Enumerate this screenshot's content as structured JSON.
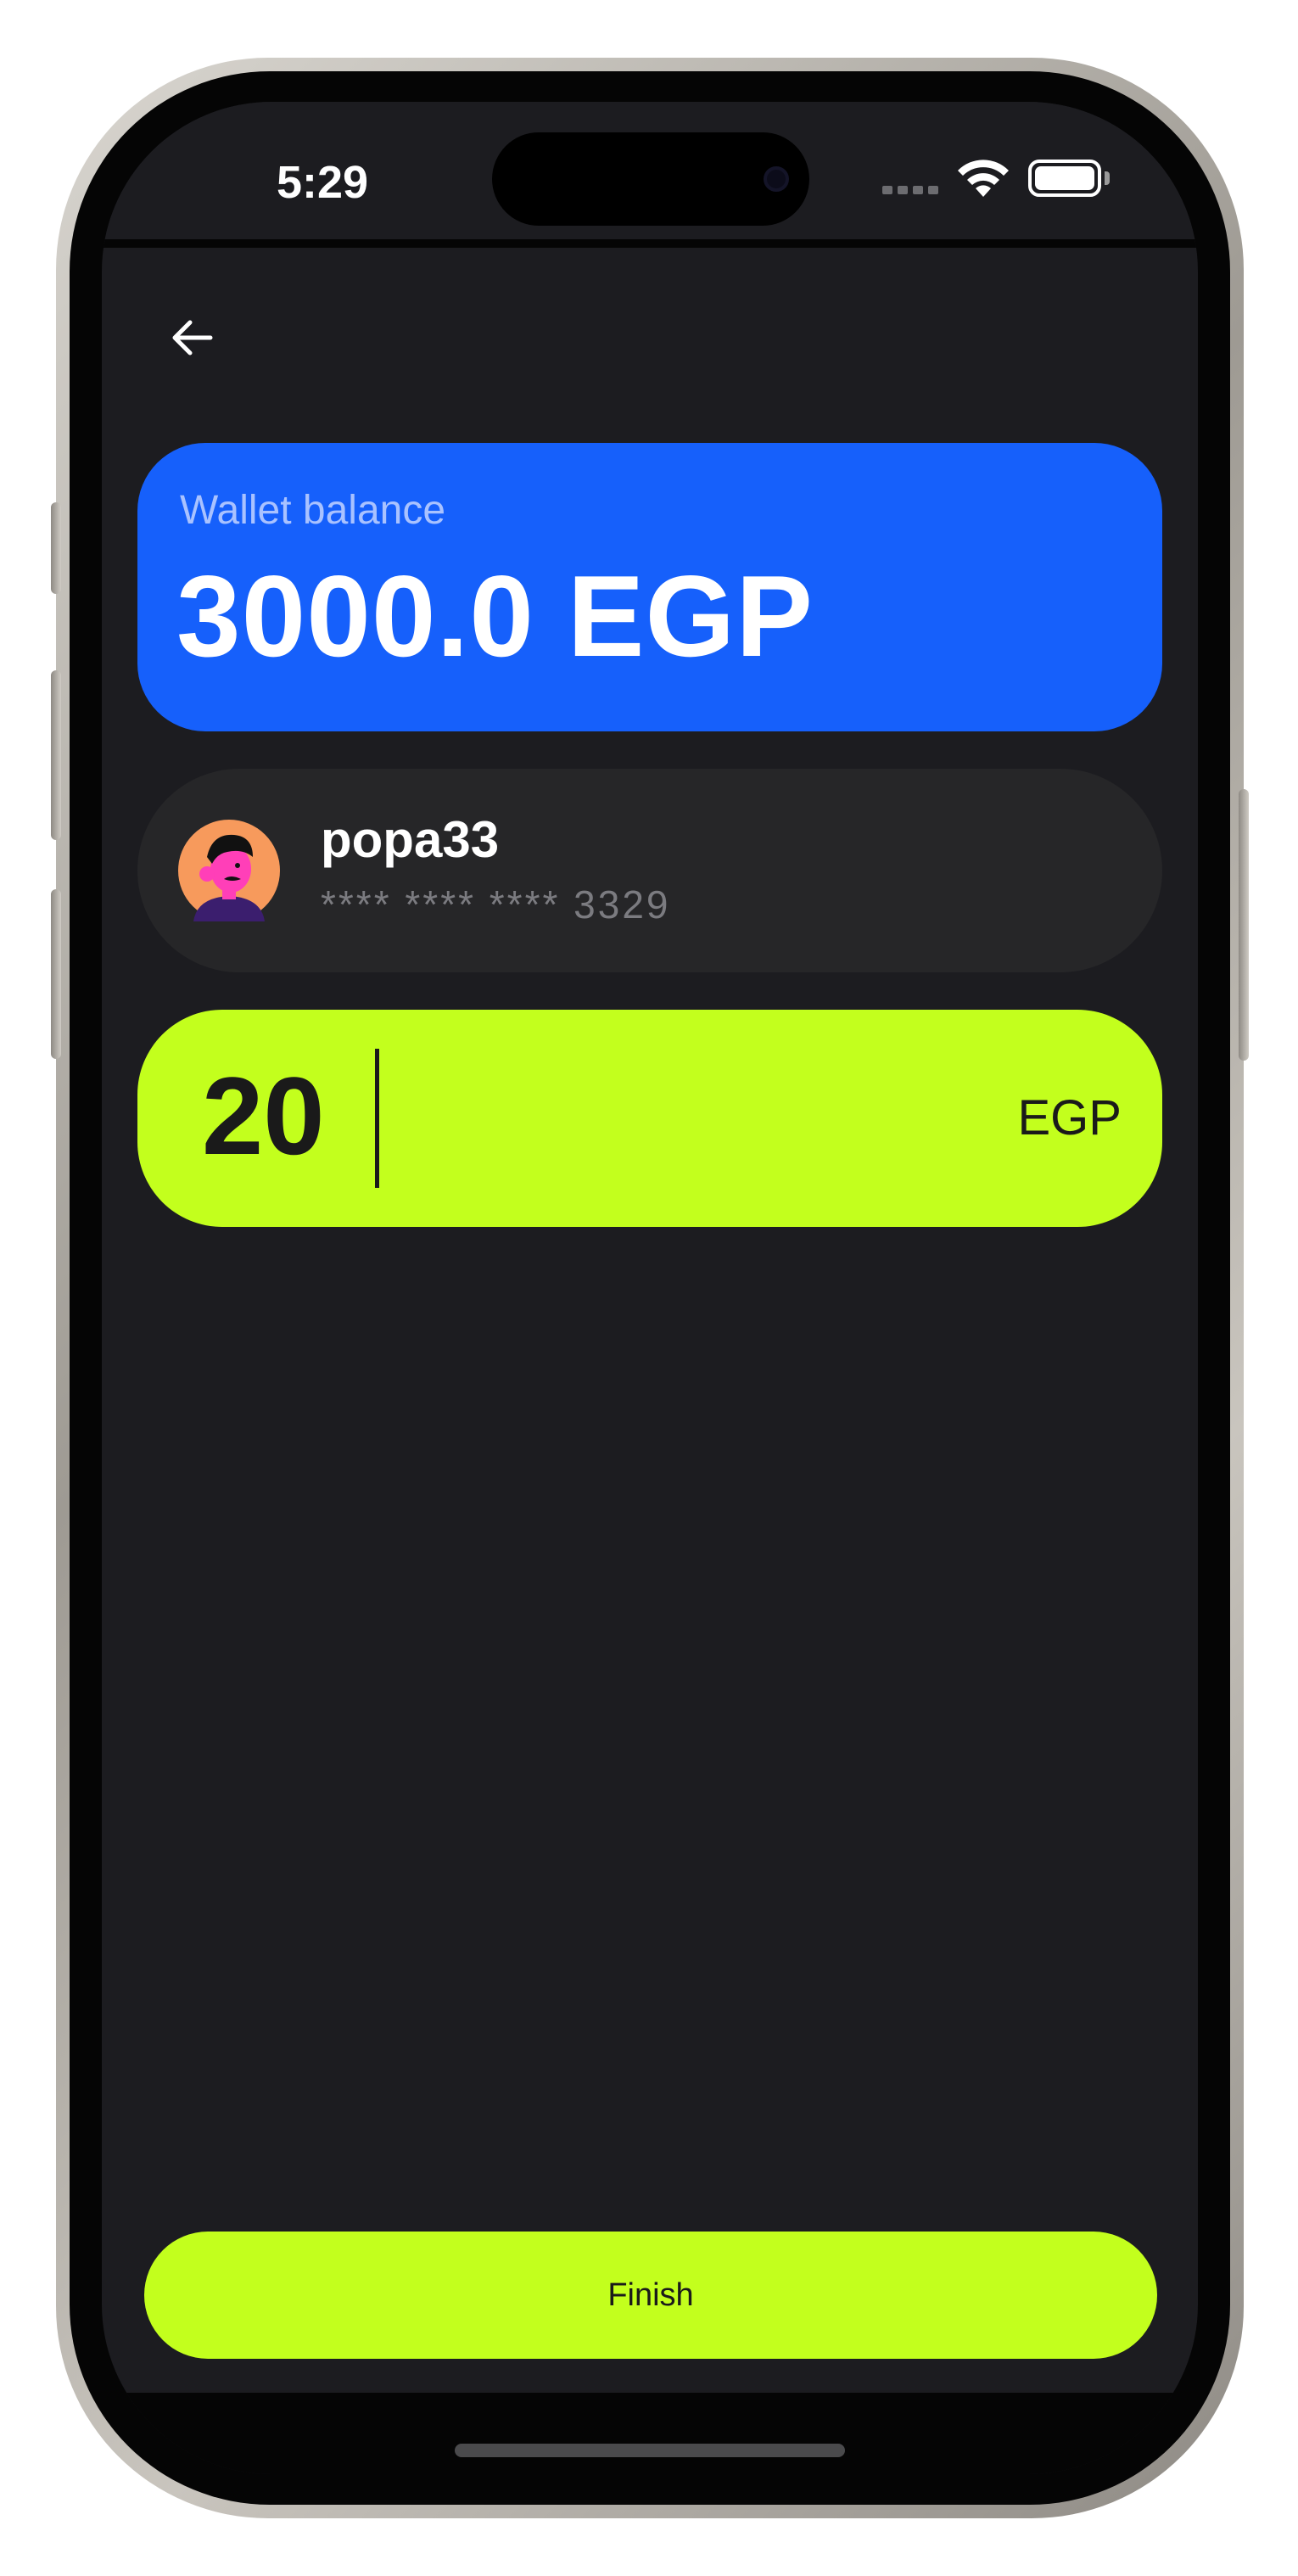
{
  "status_bar": {
    "time": "5:29",
    "icons": [
      "cellular-signal-icon",
      "wifi-icon",
      "battery-icon"
    ]
  },
  "header": {
    "back_icon": "arrow-left-icon"
  },
  "wallet": {
    "label": "Wallet balance",
    "amount": "3000.0 EGP",
    "color": "#1660fb"
  },
  "recipient": {
    "name": "popa33",
    "card_mask": "**** **** **** 3329",
    "avatar_icon": "avatar-illustration"
  },
  "amount_input": {
    "value": "20",
    "currency": "EGP",
    "color": "#c3ff1d"
  },
  "actions": {
    "finish_label": "Finish"
  }
}
